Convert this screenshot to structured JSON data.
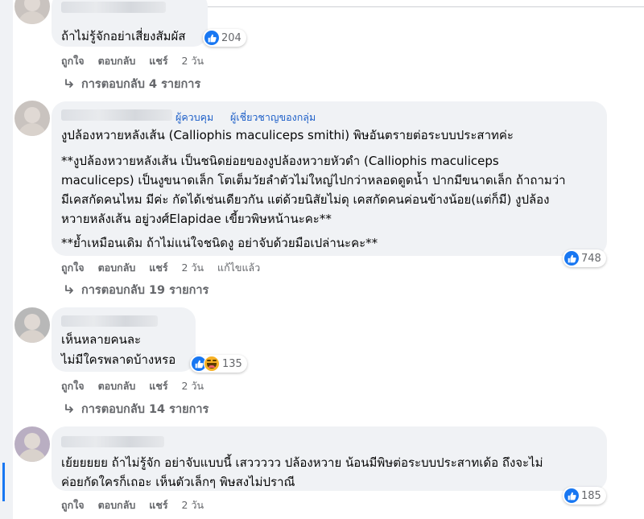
{
  "comments": [
    {
      "text_lines": [
        "ถ้าไม่รู้จักอย่าเสี่ยงสัมผัส"
      ],
      "reaction_count": "204",
      "actions": {
        "like": "ถูกใจ",
        "reply": "ตอบกลับ",
        "share": "แชร์",
        "time": "2 วัน"
      },
      "replies_label": "การตอบกลับ 4 รายการ"
    },
    {
      "badges": [
        "ผู้ควบคุม",
        "ผู้เชี่ยวชาญของกลุ่ม"
      ],
      "text_lines": [
        "งูปล้องหวายหลังเส้น (Calliophis maculiceps smithi) พิษอันตรายต่อระบบประสาทค่ะ",
        "**งูปล้องหวายหลังเส้น เป็นชนิดย่อยของงูปล้องหวายหัวดำ (Calliophis maculiceps",
        "maculiceps) เป็นงูขนาดเล็ก โตเต็มวัยลำตัวไม่ใหญ่ไปกว่าหลอดดูดน้ำ ปากมีขนาดเล็ก ถ้าถามว่า",
        "มีเคสกัดคนไหม มีค่ะ กัดได้เช่นเดียวกัน แต่ด้วยนิสัยไม่ดุ เคสกัดคนค่อนข้างน้อย(แต่ก็มี) งูปล้อง",
        "หวายหลังเส้น อยู่วงศ์Elapidae เขี้ยวพิษหน้านะคะ**",
        "**ย้ำเหมือนเดิม ถ้าไม่แน่ใจชนิดงู อย่าจับด้วยมือเปล่านะคะ**"
      ],
      "reaction_count": "748",
      "actions": {
        "like": "ถูกใจ",
        "reply": "ตอบกลับ",
        "share": "แชร์",
        "time": "2 วัน",
        "edited": "แก้ไขแล้ว"
      },
      "replies_label": "การตอบกลับ 19 รายการ"
    },
    {
      "text_lines": [
        "เห็นหลายคนละ",
        "ไม่มีใครพลาดบ้างหรอ"
      ],
      "reaction_count": "135",
      "actions": {
        "like": "ถูกใจ",
        "reply": "ตอบกลับ",
        "share": "แชร์",
        "time": "2 วัน"
      },
      "replies_label": "การตอบกลับ 14 รายการ"
    },
    {
      "text_lines": [
        "เย้ยยยยย ถ้าไม่รู้จัก อย่าจับแบบนี้ เสววววว ปล้องหวาย น้อนมีพิษต่อระบบประสาทเด้อ ถึงจะไม่",
        "ค่อยกัดใครก็เถอะ เห็นตัวเล็กๆ พิษสงไม่ปราณี"
      ],
      "reaction_count": "185",
      "actions": {
        "like": "ถูกใจ",
        "reply": "ตอบกลับ",
        "share": "แชร์",
        "time": "2 วัน"
      }
    }
  ],
  "icons": {
    "like": "like-icon",
    "haha": "haha-icon",
    "reply_arrow": "reply-arrow-icon"
  },
  "colors": {
    "accent": "#1877f2",
    "bubble": "#f0f2f5",
    "secondary_text": "#65676b",
    "badge": "#1d5fc8"
  }
}
